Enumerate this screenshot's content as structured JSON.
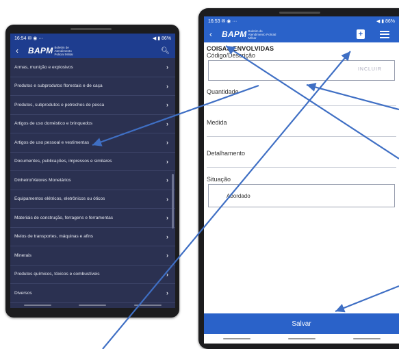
{
  "left_phone": {
    "status": {
      "time": "16:54",
      "left_icons": "✉ ◉ ···",
      "right_icons": "◀ ▮ 86%"
    },
    "appbar": {
      "logo": "BAPM",
      "logo_sub": "Boletim de Atendimento Policial Militar"
    },
    "items": [
      {
        "label": "Armas, munição e explosivos"
      },
      {
        "label": "Produtos e subprodutos florestais e de caça"
      },
      {
        "label": "Produtos, subprodutos e petrechos de pesca"
      },
      {
        "label": "Artigos de uso doméstico e brinquedos"
      },
      {
        "label": "Artigos de uso pessoal e vestimentas"
      },
      {
        "label": "Documentos, publicações, impressos e similares"
      },
      {
        "label": "Dinheiro/Valores Monetários"
      },
      {
        "label": "Equipamentos elétricos, eletrônicos ou óticos"
      },
      {
        "label": "Materiais de construção, ferragens e ferramentas"
      },
      {
        "label": "Meios de transportes, máquinas e afins"
      },
      {
        "label": "Minerais"
      },
      {
        "label": "Produtos químicos, tóxicos e combustíveis"
      },
      {
        "label": "Diversos"
      }
    ]
  },
  "right_phone": {
    "status": {
      "time": "16:53",
      "left_icons": "✉ ◉ ···",
      "right_icons": "◀ ▮ 86%"
    },
    "appbar": {
      "logo": "BAPM",
      "logo_sub": "Boletim de Atendimento Policial Militar"
    },
    "form": {
      "section_title": "COISAS ENVOLVIDAS",
      "codigo_label": "Código/Descrição",
      "codigo_hint": "INCLUIR",
      "quantidade_label": "Quantidade",
      "medida_label": "Medida",
      "detalhamento_label": "Detalhamento",
      "situacao_label": "Situação",
      "situacao_value": "Abordado"
    },
    "save_label": "Salvar"
  },
  "colors": {
    "left_bg": "#2b3151",
    "appbar_dark": "#1e3d8f",
    "appbar_blue": "#2a62c9",
    "arrow": "#3f6fc4"
  }
}
